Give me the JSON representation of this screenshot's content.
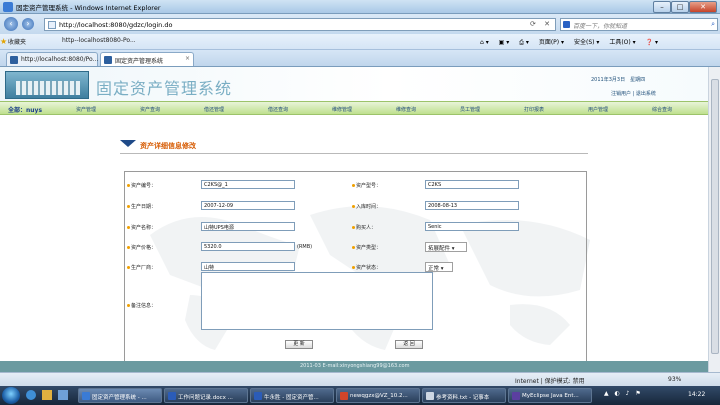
{
  "window": {
    "title": "固定资产管理系统 - Windows Internet Explorer"
  },
  "address": {
    "url": "http://localhost:8080/gdzc/login.do",
    "search_placeholder": "百度一下，你就知道"
  },
  "favorites": {
    "label": "收藏夹",
    "link": "http--localhost8080-Po..."
  },
  "commandbar": {
    "page": "页面(P) ▾",
    "safety": "安全(S) ▾",
    "tools": "工具(O) ▾",
    "help": "❓ ▾"
  },
  "tabs": [
    {
      "label": "http://localhost:8080/Po..."
    },
    {
      "label": "固定资产管理系统"
    }
  ],
  "header": {
    "system_title": "固定资产管理系统",
    "date": "2011年3月3日　星期四",
    "user_links": "注销用户 | 退出系统"
  },
  "nav": {
    "user_label": "全部：nuys",
    "items": [
      "资产管理",
      "资产查询",
      "借还管理",
      "借还查询",
      "维修管理",
      "维修查询",
      "员工管理",
      "打印报表",
      "用户管理",
      "综合查询"
    ]
  },
  "section": {
    "title": "资产详细信息修改"
  },
  "form": {
    "asset_no": {
      "label": "资产编号：",
      "value": "C2KS@_1"
    },
    "asset_model": {
      "label": "资产型号：",
      "value": "C2KS"
    },
    "production_date": {
      "label": "生产日期：",
      "value": "2007-12-09"
    },
    "storage_time": {
      "label": "入库时间：",
      "value": "2008-08-13"
    },
    "asset_name": {
      "label": "资产名称：",
      "value": "山特UPS电源"
    },
    "purchaser": {
      "label": "购买人：",
      "value": "Senic"
    },
    "price": {
      "label": "资产价格：",
      "value": "5320.0",
      "unit": "(RMB)"
    },
    "asset_type": {
      "label": "资产类型：",
      "value": "拓展配件"
    },
    "manufacturer": {
      "label": "生产厂商：",
      "value": "山特"
    },
    "asset_status": {
      "label": "资产状态：",
      "value": "正常"
    },
    "remarks": {
      "label": "备注信息：",
      "value": ""
    },
    "submit_label": "更 新",
    "back_label": "返 回"
  },
  "footer": {
    "text": "2011-03 E-mail:xinyongshiang99@163.com"
  },
  "statusbar": {
    "zone": "Internet | 保护模式: 禁用",
    "zoom": "93%"
  },
  "taskbar": {
    "items": [
      {
        "label": "固定资产管理系统 - ...",
        "color": "#3a7bd5"
      },
      {
        "label": "工作问题记录.docx ...",
        "color": "#2b5cb8"
      },
      {
        "label": "牛永胜 - 固定资产管...",
        "color": "#2b5cb8"
      },
      {
        "label": "newqgzx@VZ_10.2...",
        "color": "#d2452a"
      },
      {
        "label": "参考资料.txt - 记事本",
        "color": "#cfd8e3"
      },
      {
        "label": "MyEclipse Java Ent...",
        "color": "#5b3fa0"
      }
    ],
    "time": "14:22"
  }
}
